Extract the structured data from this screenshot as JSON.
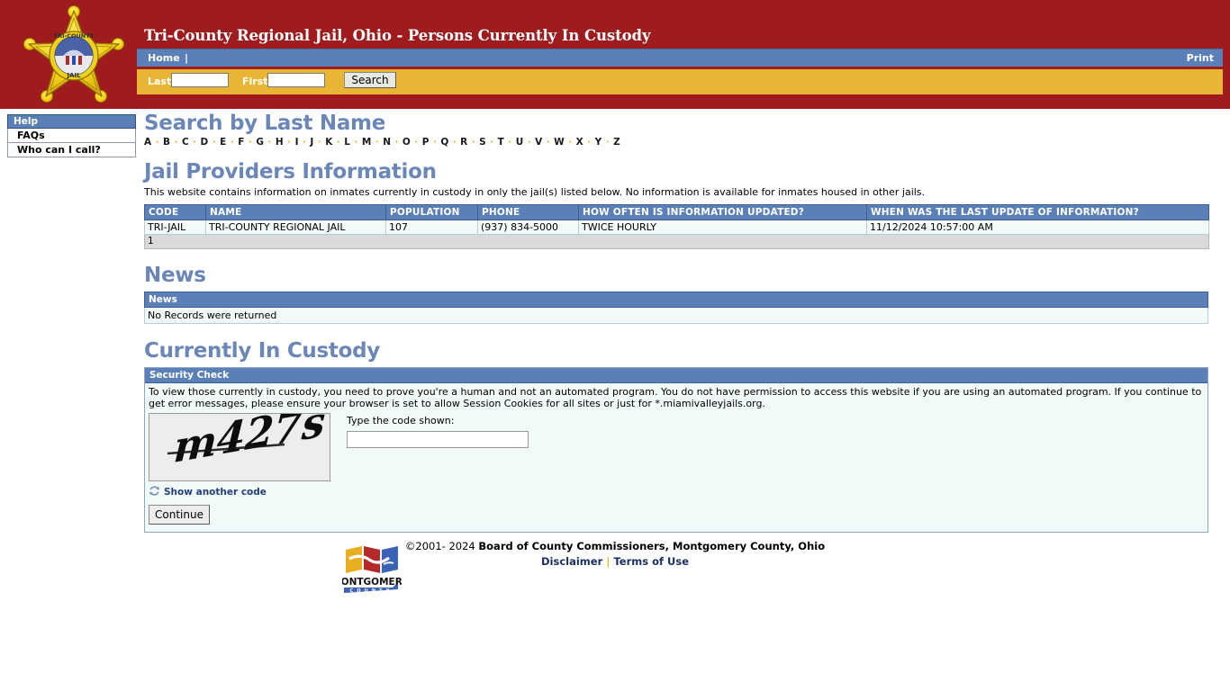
{
  "header": {
    "title": "Tri-County Regional Jail, Ohio - Persons Currently In Custody",
    "badge_alt": "tri-county-jail-star-badge",
    "badge_text_top": "TRI-COUNTY",
    "badge_text_bottom": "JAIL",
    "nav": {
      "home": "Home",
      "separator": "|",
      "print": "Print"
    },
    "search": {
      "last_label": "Last",
      "last_value": "",
      "last_placeholder": "",
      "first_label": "First",
      "first_value": "",
      "first_placeholder": "",
      "button": "Search"
    },
    "colors": {
      "maroon": "#9e1b1e",
      "blue": "#5b80b8",
      "gold": "#e8b535"
    }
  },
  "sidebar": {
    "heading": "Help",
    "items": [
      {
        "label": "FAQs"
      },
      {
        "label": "Who can I call?"
      }
    ]
  },
  "search_by_last_name": {
    "title": "Search by Last Name",
    "letters": [
      "A",
      "B",
      "C",
      "D",
      "E",
      "F",
      "G",
      "H",
      "I",
      "J",
      "K",
      "L",
      "M",
      "N",
      "O",
      "P",
      "Q",
      "R",
      "S",
      "T",
      "U",
      "V",
      "W",
      "X",
      "Y",
      "Z"
    ],
    "separator": "·"
  },
  "providers": {
    "title": "Jail Providers Information",
    "description": "This website contains information on inmates currently in custody in only the jail(s) listed below. No information is available for inmates housed in other jails.",
    "columns": [
      "CODE",
      "NAME",
      "POPULATION",
      "PHONE",
      "HOW OFTEN IS INFORMATION UPDATED?",
      "WHEN WAS THE LAST UPDATE OF INFORMATION?"
    ],
    "rows": [
      {
        "code": "TRI-JAIL",
        "name": "TRI-COUNTY REGIONAL JAIL",
        "population": "107",
        "phone": "(937) 834-5000",
        "update_frequency": "TWICE HOURLY",
        "last_update": "11/12/2024 10:57:00 AM"
      }
    ],
    "pager": "1"
  },
  "news": {
    "title": "News",
    "column": "News",
    "empty_message": "No Records were returned"
  },
  "custody": {
    "title": "Currently In Custody",
    "security_check": {
      "heading": "Security Check",
      "message": "To view those currently in custody, you need to prove you're a human and not an automated program. You do not have permission to access this website if you are using an automated program. If you continue to get error messages, please ensure your browser is set to allow Session Cookies for all sites or just for *.miamivalleyjails.org.",
      "captcha_code": "m427s",
      "input_label": "Type the code shown:",
      "input_value": "",
      "input_placeholder": "",
      "refresh_link": "Show another code",
      "continue_button": "Continue"
    }
  },
  "footer": {
    "copyright_prefix": "©2001- 2024 ",
    "copyright_owner": "Board of County Commissioners, Montgomery County, Ohio",
    "disclaimer": "Disclaimer",
    "separator": "|",
    "terms": "Terms of Use",
    "logo_line1": "MONTGOMERY",
    "logo_line2": "C O U N T Y"
  }
}
